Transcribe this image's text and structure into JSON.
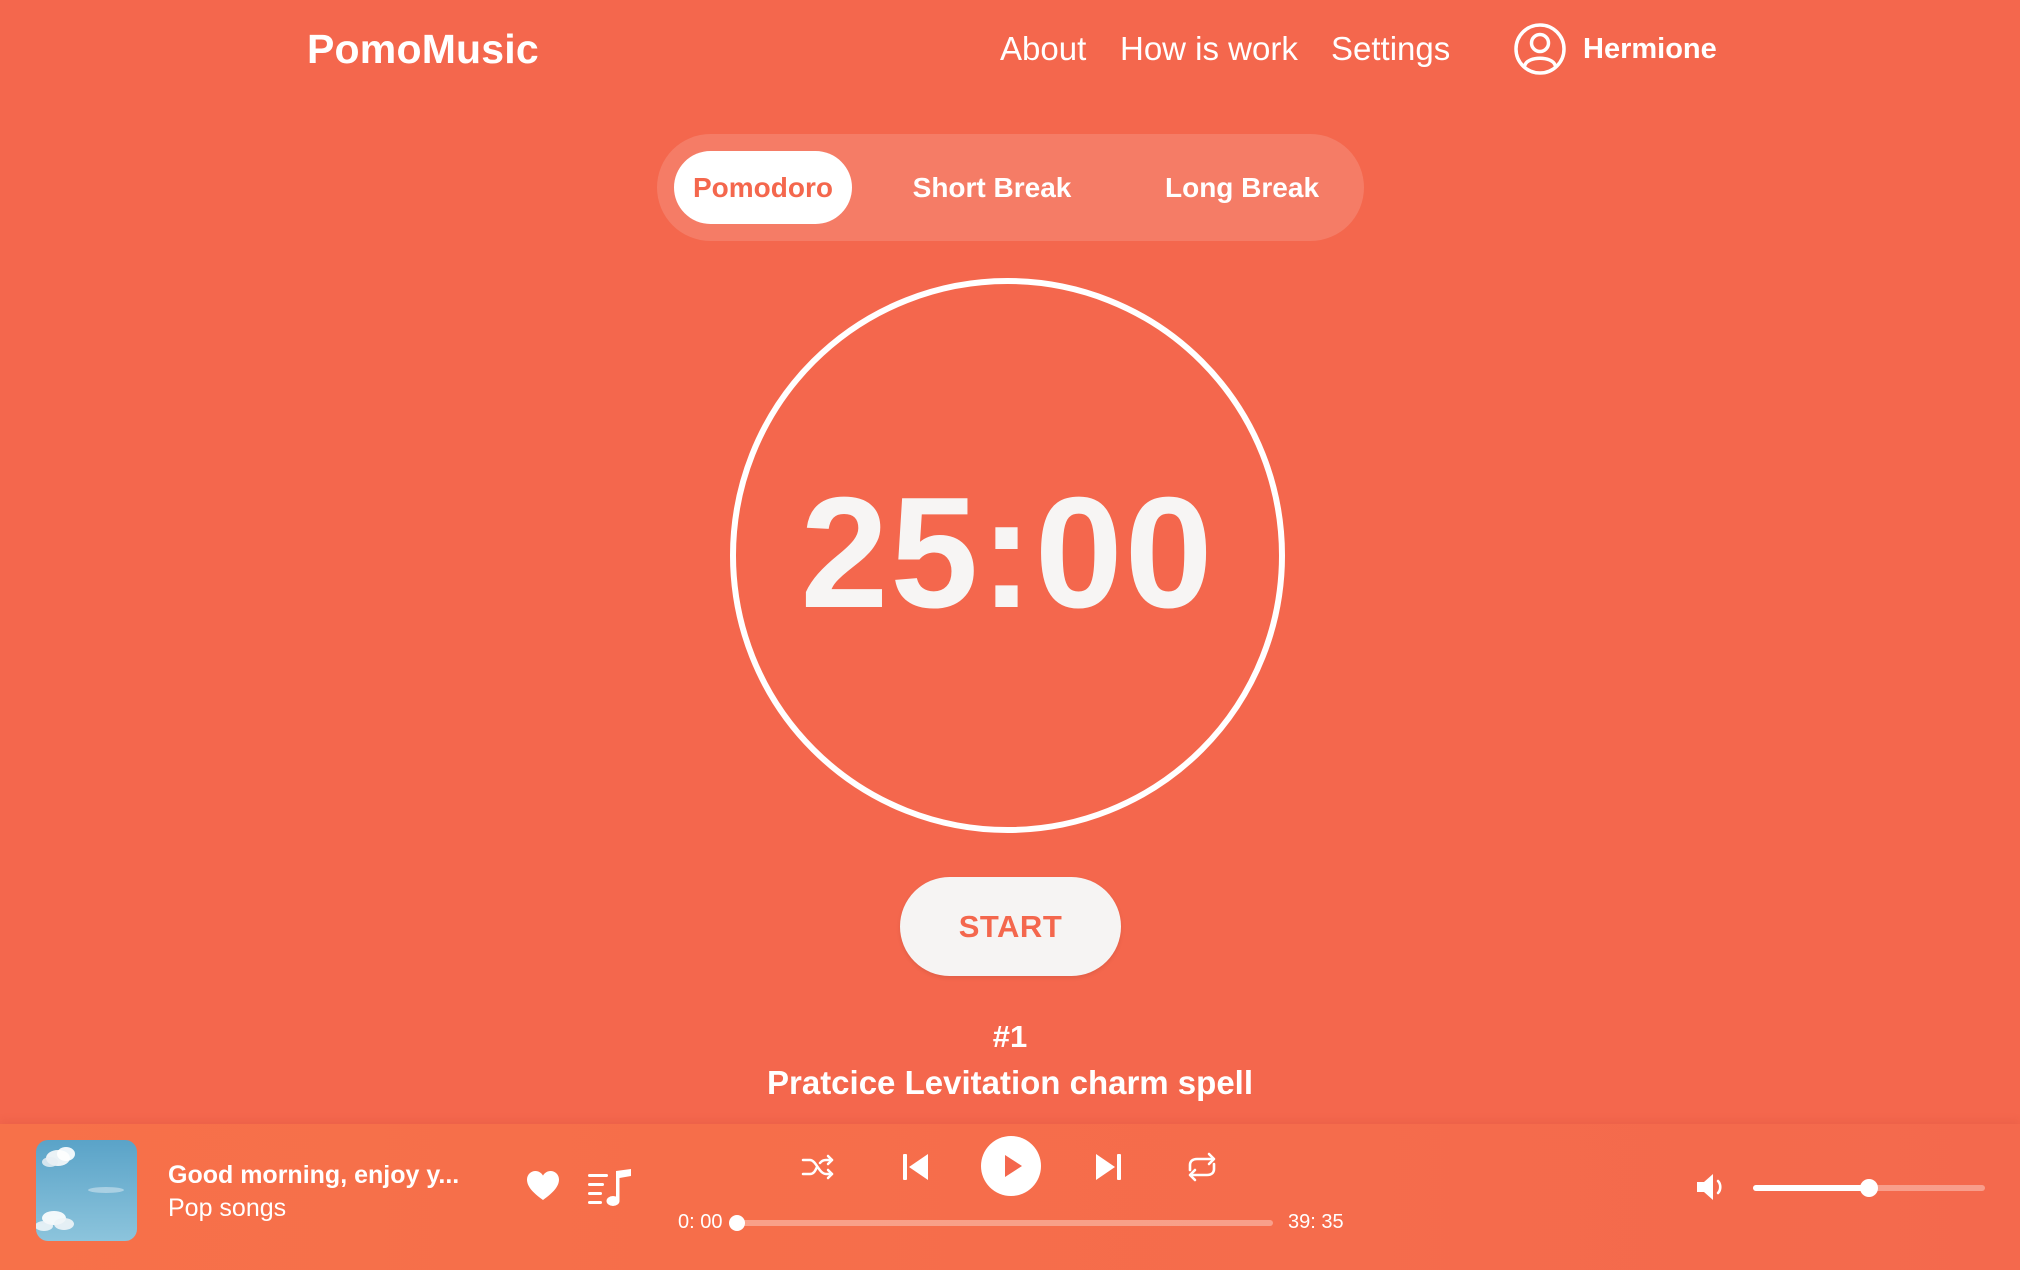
{
  "app": {
    "brand": "PomoMusic",
    "accent_color": "#f4674d"
  },
  "nav": {
    "items": [
      {
        "label": "About"
      },
      {
        "label": "How is work"
      },
      {
        "label": "Settings"
      }
    ],
    "user": {
      "name": "Hermione",
      "icon": "user-circle-icon"
    }
  },
  "tabs": {
    "items": [
      {
        "label": "Pomodoro",
        "active": true
      },
      {
        "label": "Short Break",
        "active": false
      },
      {
        "label": "Long Break",
        "active": false
      }
    ]
  },
  "timer": {
    "display": "25:00",
    "start_label": "START"
  },
  "task": {
    "number": "#1",
    "title": "Pratcice Levitation charm spell"
  },
  "player": {
    "track_title": "Good morning, enjoy y...",
    "playlist_name": "Pop songs",
    "album_art_icon": "sky-clouds-image",
    "controls": {
      "like_icon": "heart-icon",
      "playlist_icon": "playlist-icon",
      "shuffle_icon": "shuffle-icon",
      "previous_icon": "skip-previous-icon",
      "play_icon": "play-icon",
      "next_icon": "skip-next-icon",
      "repeat_icon": "repeat-icon",
      "volume_icon": "volume-icon"
    },
    "time_current": "0: 00",
    "time_total": "39: 35",
    "progress_fraction": 0.0,
    "volume_fraction": 0.5
  }
}
